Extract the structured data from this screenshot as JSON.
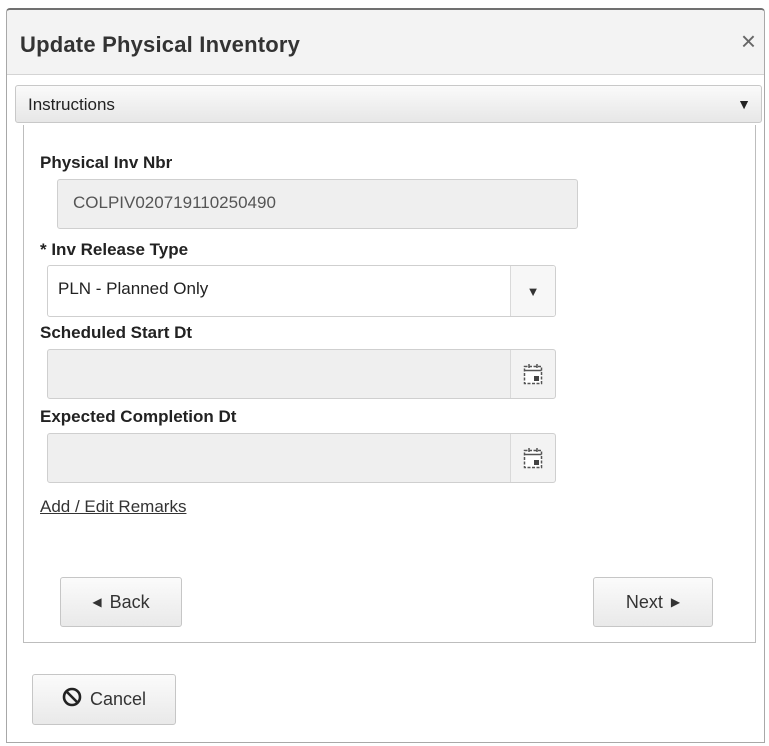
{
  "dialog": {
    "title": "Update Physical Inventory",
    "close_icon": "×"
  },
  "instructions": {
    "label": "Instructions",
    "caret": "▼"
  },
  "form": {
    "physical_inv_nbr": {
      "label": "Physical Inv Nbr",
      "value": "COLPIV020719110250490"
    },
    "inv_release_type": {
      "label": "* Inv Release Type",
      "value": "PLN - Planned Only",
      "caret": "▼"
    },
    "scheduled_start_dt": {
      "label": "Scheduled Start Dt",
      "value": ""
    },
    "expected_completion_dt": {
      "label": "Expected Completion Dt",
      "value": ""
    },
    "remarks_link": "Add / Edit Remarks"
  },
  "navigation": {
    "back_label": "Back",
    "back_icon": "◀",
    "next_label": "Next",
    "next_icon": "▶"
  },
  "footer": {
    "cancel_label": "Cancel"
  },
  "icons": {
    "calendar": "calendar-icon",
    "cancel": "no-entry-icon"
  },
  "colors": {
    "titlebar_bg": "#f3f3f3",
    "readonly_field_bg": "#efefef",
    "border": "#cfcfcf"
  }
}
